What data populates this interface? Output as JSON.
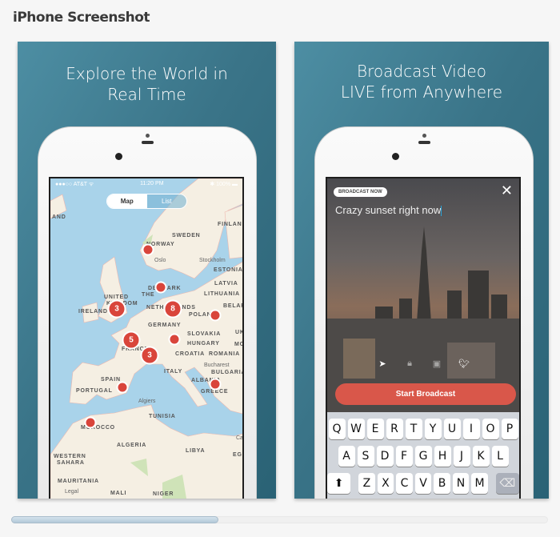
{
  "page_title": "iPhone Screenshot",
  "screenshots": [
    {
      "headline_line1": "Explore the World in",
      "headline_line2": "Real Time",
      "status": {
        "carrier": "●●●○○ AT&T ᯤ",
        "time": "11:20 PM",
        "battery": "✱ 100% ▬"
      },
      "segmented": {
        "map": "Map",
        "list": "List",
        "selected": "Map"
      },
      "map_labels": [
        "AND",
        "FINLAND",
        "SWEDEN",
        "NORWAY",
        "ESTONIA",
        "LATVIA",
        "LITHUANIA",
        "DENMARK",
        "UNITED",
        "KINGDOM",
        "IRELAND",
        "THE",
        "NETHERLANDS",
        "GERMANY",
        "POLAND",
        "BELARUS",
        "SLOVAKIA",
        "HUNGARY",
        "UKR",
        "MOLDOVA",
        "FRANCE",
        "CROATIA",
        "ROMANIA",
        "BULGARIA",
        "ITALY",
        "ALBANIA",
        "GREECE",
        "SPAIN",
        "PORTUGAL",
        "TUNISIA",
        "MOROCCO",
        "ALGERIA",
        "LIBYA",
        "EGYPT",
        "WESTERN",
        "SAHARA",
        "MAURITANIA",
        "MALI",
        "NIGER"
      ],
      "map_cities": [
        "Oslo",
        "Stockholm",
        "Bucharest",
        "Algiers",
        "Cairo"
      ],
      "legal": "Legal",
      "cluster_counts": [
        "3",
        "8",
        "5",
        "3"
      ]
    },
    {
      "headline_line1": "Broadcast Video",
      "headline_line2": "LIVE from Anywhere",
      "badge": "BROADCAST NOW",
      "close": "✕",
      "caption": "Crazy sunset right now",
      "share_icons": [
        "location-arrow-icon",
        "lock-icon",
        "contacts-icon",
        "twitter-icon"
      ],
      "start_button": "Start Broadcast",
      "keyboard": {
        "row1": [
          "Q",
          "W",
          "E",
          "R",
          "T",
          "Y",
          "U",
          "I",
          "O",
          "P"
        ],
        "row2": [
          "A",
          "S",
          "D",
          "F",
          "G",
          "H",
          "J",
          "K",
          "L"
        ],
        "row3": [
          "Z",
          "X",
          "C",
          "V",
          "B",
          "N",
          "M"
        ],
        "shift": "⬆",
        "delete": "⌫"
      }
    }
  ],
  "colors": {
    "accent_red": "#d9574a",
    "card_teal": "#3a7488"
  },
  "scrollbar": {
    "position_fraction": 0.0,
    "visible_fraction": 0.38
  }
}
